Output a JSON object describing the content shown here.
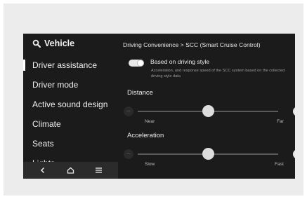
{
  "sidebar": {
    "title": "Vehicle",
    "items": [
      {
        "label": "Driver assistance",
        "active": true
      },
      {
        "label": "Driver mode",
        "active": false
      },
      {
        "label": "Active sound design",
        "active": false
      },
      {
        "label": "Climate",
        "active": false
      },
      {
        "label": "Seats",
        "active": false
      },
      {
        "label": "Lights",
        "active": false
      }
    ]
  },
  "navbar": {
    "back_icon": "chevron-left-icon",
    "home_icon": "home-icon",
    "menu_icon": "hamburger-menu-icon"
  },
  "main": {
    "breadcrumb": "Driving Convenience > SCC (Smart Cruise Control)",
    "toggle": {
      "label": "Based on driving style",
      "on": true,
      "description": "Acceleration, and response speed of the SCC system based on the collected driving style data"
    },
    "distance": {
      "title": "Distance",
      "min_label": "Near",
      "max_label": "Far",
      "level": 0.5
    },
    "acceleration": {
      "title": "Acceleration",
      "min_label": "Slow",
      "max_label": "Fast",
      "level": 0.5
    }
  },
  "colors": {
    "screen_bg": "#1b1b1b",
    "frame_bg": "#ececec",
    "accent": "#e6e6e6"
  }
}
